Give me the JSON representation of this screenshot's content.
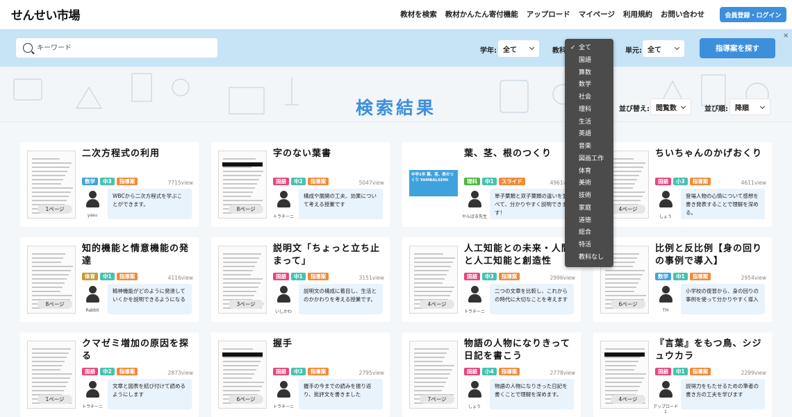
{
  "header": {
    "logo": "せんせい市場",
    "nav": [
      "教材を検索",
      "教材かんたん寄付機能",
      "アップロード",
      "マイページ",
      "利用規約",
      "お問い合わせ"
    ],
    "login_label": "会員登録・ログイン"
  },
  "search": {
    "placeholder": "キーワード",
    "grade_label": "学年:",
    "grade_value": "全て",
    "subject_label": "教科:",
    "unit_label": "単元:",
    "unit_value": "全て",
    "find_label": "指導案を探す",
    "close": "×"
  },
  "subject_dropdown": {
    "selected": "全て",
    "options": [
      "全て",
      "国語",
      "算数",
      "数学",
      "社会",
      "理科",
      "生活",
      "英語",
      "音楽",
      "図画工作",
      "体育",
      "美術",
      "技術",
      "家庭",
      "道徳",
      "総合",
      "特活",
      "教科なし"
    ]
  },
  "results": {
    "title": "検索結果",
    "sort_label": "並び替え:",
    "sort_value": "閲覧数",
    "order_label": "並び順:",
    "order_value": "降順"
  },
  "cards": [
    {
      "title": "二次方程式の利用",
      "tags": [
        [
          "数学",
          "blue"
        ],
        [
          "中3",
          "teal"
        ],
        [
          "指導案",
          "orange"
        ]
      ],
      "views": "7715view",
      "desc": "WBCから二次方程式を学ぶことができます。",
      "author": "yasu",
      "pages": "1ページ"
    },
    {
      "title": "字のない葉書",
      "tags": [
        [
          "国語",
          "red"
        ],
        [
          "中2",
          "teal"
        ],
        [
          "指導案",
          "orange"
        ]
      ],
      "views": "5047view",
      "desc": "構成や展開の工夫、効果について考える授業です",
      "author": "トラチーニ",
      "pages": "8ページ"
    },
    {
      "title": "葉、茎、根のつくり",
      "tags": [
        [
          "理科",
          "green"
        ],
        [
          "中1",
          "teal"
        ],
        [
          "スライド",
          "orange"
        ]
      ],
      "views": "4961view",
      "desc": "単子葉類と双子葉類の違いを並べて、分かりやすく説明できます！",
      "author": "やんばる先生",
      "pages": "",
      "thumb_text": "中学1年 葉、茎、根のつくり YAMBALSEMI"
    },
    {
      "title": "ちいちゃんのかげおくり",
      "tags": [
        [
          "国語",
          "red"
        ],
        [
          "小3",
          "teal"
        ],
        [
          "指導案",
          "orange"
        ]
      ],
      "views": "4611view",
      "desc": "登場人物の心情について感想を書き発表することで理解を深める。",
      "author": "しょう",
      "pages": "4ページ"
    },
    {
      "title": "知的機能と情意機能の発達",
      "tags": [
        [
          "体育",
          "brown"
        ],
        [
          "中1",
          "teal"
        ],
        [
          "指導案",
          "orange"
        ]
      ],
      "views": "4116view",
      "desc": "精神機能がどのように発達していくかを説明できるようになる",
      "author": "Rabbit",
      "pages": "8ページ"
    },
    {
      "title": "説明文「ちょっと立ち止まって」",
      "tags": [
        [
          "国語",
          "red"
        ],
        [
          "中1",
          "teal"
        ],
        [
          "指導案",
          "orange"
        ]
      ],
      "views": "3151view",
      "desc": "説明文の構成に着目し、生活とのかかわりを考える授業です。",
      "author": "いしかわ",
      "pages": "3ページ"
    },
    {
      "title": "人工知能との未来・人間と人工知能と創造性",
      "tags": [
        [
          "国語",
          "red"
        ],
        [
          "中3",
          "teal"
        ],
        [
          "指導案",
          "orange"
        ]
      ],
      "views": "2996view",
      "desc": "二つの文章を比較し、これからの時代に大切なことを考えます",
      "author": "トラチーニ",
      "pages": "4ページ"
    },
    {
      "title": "比例と反比例【身の回りの事例で導入】",
      "tags": [
        [
          "数学",
          "blue"
        ],
        [
          "中1",
          "teal"
        ],
        [
          "指導案",
          "orange"
        ]
      ],
      "views": "2954view",
      "desc": "小学校の復習から、身の回りの事例を使って分かりやすく導入",
      "author": "TH",
      "pages": "6ページ"
    },
    {
      "title": "クマゼミ増加の原因を探る",
      "tags": [
        [
          "国語",
          "red"
        ],
        [
          "中2",
          "teal"
        ],
        [
          "指導案",
          "orange"
        ]
      ],
      "views": "2873view",
      "desc": "文章と図表を結び付けて読めるようにします",
      "author": "トラチーニ",
      "pages": "1ページ"
    },
    {
      "title": "握手",
      "tags": [
        [
          "国語",
          "red"
        ],
        [
          "中3",
          "teal"
        ],
        [
          "指導案",
          "orange"
        ]
      ],
      "views": "2795view",
      "desc": "握手の今までの読みを振り返り、批評文を書きました",
      "author": "トラチーニ",
      "pages": "6ページ"
    },
    {
      "title": "物語の人物になりきって日記を書こう",
      "tags": [
        [
          "国語",
          "red"
        ],
        [
          "小4",
          "teal"
        ],
        [
          "指導案",
          "orange"
        ]
      ],
      "views": "2778view",
      "desc": "物語の人物になりきった日記を書くことで理解を深めます。",
      "author": "しょう",
      "pages": "7ページ"
    },
    {
      "title": "『言葉』をもつ鳥、シジュウカラ",
      "tags": [
        [
          "国語",
          "red"
        ],
        [
          "中1",
          "teal"
        ],
        [
          "指導案",
          "orange"
        ]
      ],
      "views": "2299view",
      "desc": "説得力をもたせるための筆者の書き方の工夫を学びます",
      "author": "アップロード1",
      "pages": "4ページ"
    }
  ]
}
